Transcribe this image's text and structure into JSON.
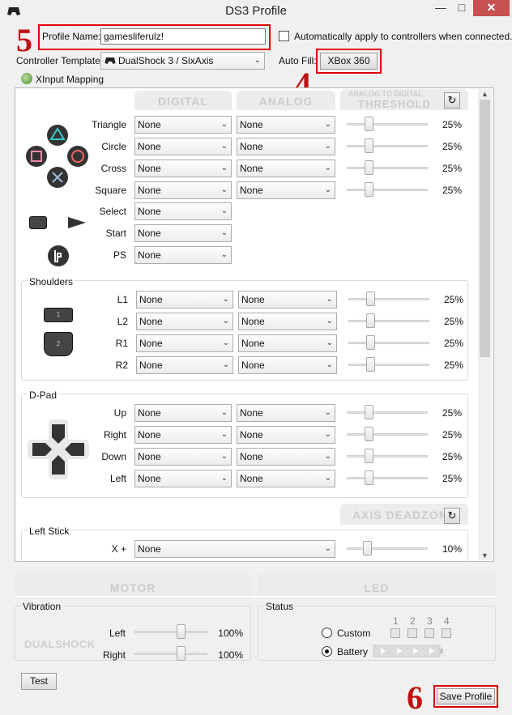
{
  "window": {
    "title": "DS3 Profile",
    "min": "—",
    "max": "□",
    "close": "✕"
  },
  "profile": {
    "name_label": "Profile Name:",
    "name_value": "gamesliferulz!",
    "auto_apply_label": "Automatically apply to controllers when connected.",
    "auto_apply_checked": false,
    "template_label": "Controller Template:",
    "template_value": "DualShock 3 / SixAxis",
    "autofill_label": "Auto Fill:",
    "autofill_button": "XBox 360"
  },
  "annotations": {
    "n4": "4",
    "n5": "5",
    "n6": "6"
  },
  "mapping": {
    "tree_label": "XInput Mapping",
    "headers": {
      "digital": "DIGITAL",
      "analog": "ANALOG",
      "threshold_top": "ANALOG TO DIGITAL",
      "threshold": "THRESHOLD",
      "deadzone": "AXIS DEADZONE"
    },
    "face": [
      {
        "label": "Triangle",
        "digital": "None",
        "analog": "None",
        "pct": "25%",
        "threshold": 0.25
      },
      {
        "label": "Circle",
        "digital": "None",
        "analog": "None",
        "pct": "25%",
        "threshold": 0.25
      },
      {
        "label": "Cross",
        "digital": "None",
        "analog": "None",
        "pct": "25%",
        "threshold": 0.25
      },
      {
        "label": "Square",
        "digital": "None",
        "analog": "None",
        "pct": "25%",
        "threshold": 0.25
      }
    ],
    "system": [
      {
        "label": "Select",
        "digital": "None"
      },
      {
        "label": "Start",
        "digital": "None"
      },
      {
        "label": "PS",
        "digital": "None"
      }
    ],
    "shoulders_title": "Shoulders",
    "shoulders": [
      {
        "label": "L1",
        "digital": "None",
        "analog": "None",
        "pct": "25%",
        "threshold": 0.25
      },
      {
        "label": "L2",
        "digital": "None",
        "analog": "None",
        "pct": "25%",
        "threshold": 0.25
      },
      {
        "label": "R1",
        "digital": "None",
        "analog": "None",
        "pct": "25%",
        "threshold": 0.25
      },
      {
        "label": "R2",
        "digital": "None",
        "analog": "None",
        "pct": "25%",
        "threshold": 0.25
      }
    ],
    "shoulder_icon_labels": {
      "one": "1",
      "two": "2"
    },
    "dpad_title": "D-Pad",
    "dpad": [
      {
        "label": "Up",
        "digital": "None",
        "analog": "None",
        "pct": "25%",
        "threshold": 0.25
      },
      {
        "label": "Right",
        "digital": "None",
        "analog": "None",
        "pct": "25%",
        "threshold": 0.25
      },
      {
        "label": "Down",
        "digital": "None",
        "analog": "None",
        "pct": "25%",
        "threshold": 0.25
      },
      {
        "label": "Left",
        "digital": "None",
        "analog": "None",
        "pct": "25%",
        "threshold": 0.25
      }
    ],
    "leftstick_title": "Left Stick",
    "leftstick": [
      {
        "label": "X +",
        "digital": "None",
        "pct": "10%",
        "deadzone": 0.1
      }
    ]
  },
  "motor": {
    "header": "MOTOR",
    "vibration_title": "Vibration",
    "logo": "DUALSHOCK",
    "left_label": "Left",
    "left_pct": "100%",
    "left_level": 1.0,
    "right_label": "Right",
    "right_pct": "100%",
    "right_level": 1.0,
    "test_button": "Test"
  },
  "led": {
    "header": "LED",
    "status_title": "Status",
    "columns": [
      "1",
      "2",
      "3",
      "4"
    ],
    "custom_label": "Custom",
    "battery_label": "Battery",
    "selected": "Battery"
  },
  "footer": {
    "save_button": "Save Profile"
  },
  "colors": {
    "close": "#c75050",
    "annotation": "#e00000",
    "headers": "#cccccc"
  }
}
